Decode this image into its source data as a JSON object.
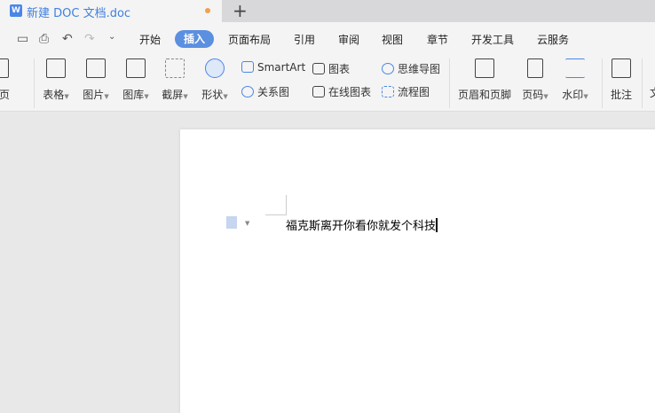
{
  "tab": {
    "title": "新建 DOC 文档.doc",
    "new_tab": "+"
  },
  "quick_access": [
    "save-icon",
    "print-icon",
    "undo-icon",
    "redo-icon",
    "more-icon"
  ],
  "menu": [
    "开始",
    "插入",
    "页面布局",
    "引用",
    "审阅",
    "视图",
    "章节",
    "开发工具",
    "云服务"
  ],
  "active_menu": "插入",
  "ribbon": {
    "partial_left": "白页",
    "big": [
      {
        "label": "表格",
        "icon": "table-icon"
      },
      {
        "label": "图片",
        "icon": "picture-icon"
      },
      {
        "label": "图库",
        "icon": "gallery-icon"
      },
      {
        "label": "截屏",
        "icon": "screenshot-icon"
      },
      {
        "label": "形状",
        "icon": "shape-icon"
      }
    ],
    "small": [
      {
        "label": "SmartArt"
      },
      {
        "label": "关系图"
      },
      {
        "label": "图表"
      },
      {
        "label": "在线图表"
      },
      {
        "label": "思维导图"
      },
      {
        "label": "流程图"
      }
    ],
    "big2": [
      {
        "label": "页眉和页脚"
      },
      {
        "label": "页码"
      },
      {
        "label": "水印"
      },
      {
        "label": "批注"
      }
    ],
    "partial_right": "文"
  },
  "document": {
    "text": "福克斯离开你看你就发个科技"
  },
  "colors": {
    "accent": "#5b8fe0"
  }
}
